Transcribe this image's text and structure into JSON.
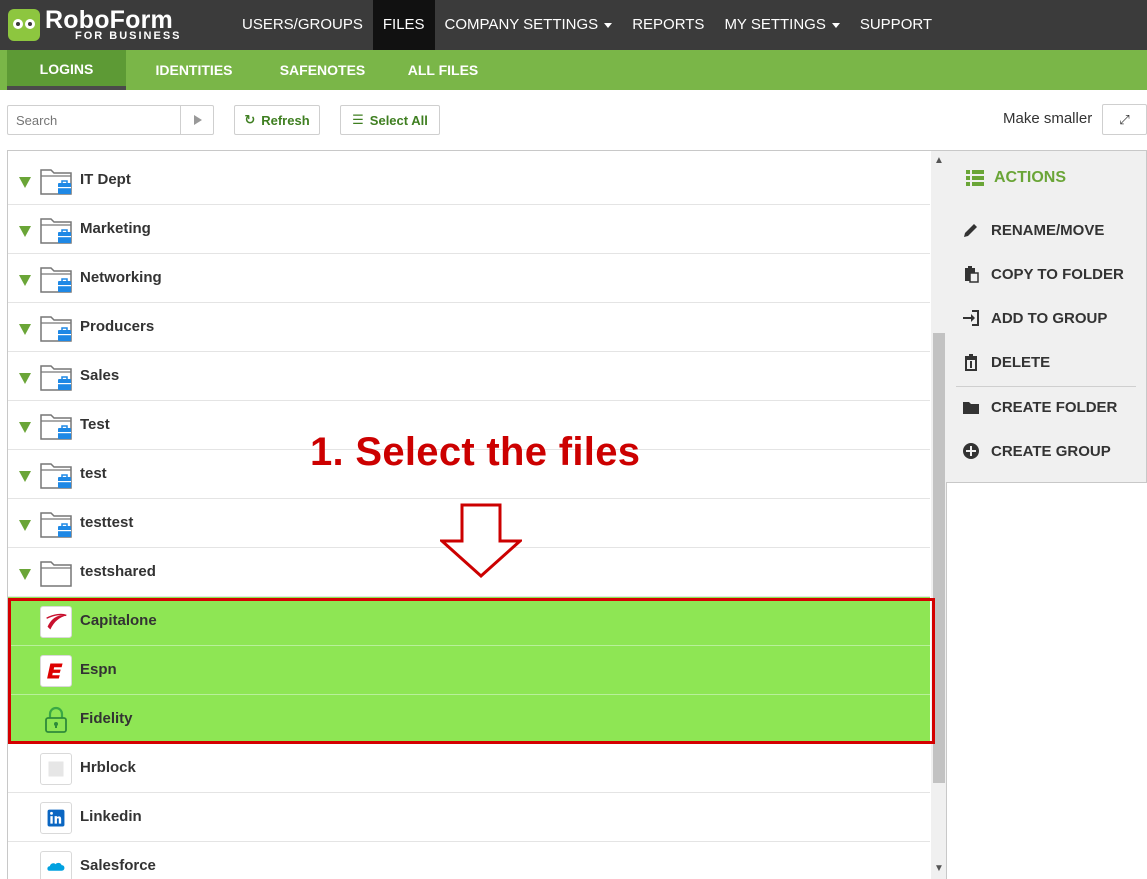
{
  "app": {
    "name": "RoboForm",
    "subtitle": "FOR BUSINESS"
  },
  "topnav": [
    {
      "label": "USERS/GROUPS",
      "dropdown": false,
      "active": false
    },
    {
      "label": "FILES",
      "dropdown": false,
      "active": true
    },
    {
      "label": "COMPANY SETTINGS",
      "dropdown": true,
      "active": false
    },
    {
      "label": "REPORTS",
      "dropdown": false,
      "active": false
    },
    {
      "label": "MY SETTINGS",
      "dropdown": true,
      "active": false
    },
    {
      "label": "SUPPORT",
      "dropdown": false,
      "active": false
    }
  ],
  "subnav": [
    {
      "label": "LOGINS",
      "active": true
    },
    {
      "label": "IDENTITIES",
      "active": false
    },
    {
      "label": "SAFENOTES",
      "active": false
    },
    {
      "label": "ALL FILES",
      "active": false
    }
  ],
  "toolbar": {
    "search_placeholder": "Search",
    "refresh_label": "Refresh",
    "select_all_label": "Select All",
    "make_smaller_label": "Make smaller"
  },
  "files": [
    {
      "name": "IT Dept",
      "kind": "folder",
      "shared": true,
      "selected": false
    },
    {
      "name": "Marketing",
      "kind": "folder",
      "shared": true,
      "selected": false
    },
    {
      "name": "Networking",
      "kind": "folder",
      "shared": true,
      "selected": false
    },
    {
      "name": "Producers",
      "kind": "folder",
      "shared": true,
      "selected": false
    },
    {
      "name": "Sales",
      "kind": "folder",
      "shared": true,
      "selected": false
    },
    {
      "name": "Test",
      "kind": "folder",
      "shared": true,
      "selected": false
    },
    {
      "name": "test",
      "kind": "folder",
      "shared": true,
      "selected": false
    },
    {
      "name": "testtest",
      "kind": "folder",
      "shared": true,
      "selected": false
    },
    {
      "name": "testshared",
      "kind": "folder",
      "shared": false,
      "selected": false
    },
    {
      "name": "Capitalone",
      "kind": "login",
      "icon": "capitalone-icon",
      "selected": true
    },
    {
      "name": "Espn",
      "kind": "login",
      "icon": "espn-icon",
      "selected": true
    },
    {
      "name": "Fidelity",
      "kind": "login",
      "icon": "lock-icon",
      "selected": true
    },
    {
      "name": "Hrblock",
      "kind": "login",
      "icon": "blank-site-icon",
      "selected": false
    },
    {
      "name": "Linkedin",
      "kind": "login",
      "icon": "linkedin-icon",
      "selected": false
    },
    {
      "name": "Salesforce",
      "kind": "login",
      "icon": "salesforce-icon",
      "selected": false
    }
  ],
  "annotation": {
    "text": "1. Select the files"
  },
  "actions": {
    "title": "ACTIONS",
    "items": [
      {
        "label": "RENAME/MOVE",
        "icon": "pencil-icon"
      },
      {
        "label": "COPY TO FOLDER",
        "icon": "clipboard-icon"
      },
      {
        "label": "ADD TO GROUP",
        "icon": "sign-in-icon"
      },
      {
        "label": "DELETE",
        "icon": "trash-icon"
      },
      {
        "label": "CREATE FOLDER",
        "icon": "folder-icon"
      },
      {
        "label": "CREATE GROUP",
        "icon": "plus-circle-icon"
      }
    ]
  },
  "colors": {
    "topbar": "#3b3b3b",
    "subbar": "#7ab648",
    "accent_green": "#6aa537",
    "selected_row": "#8ee654",
    "annotation_red": "#cc0000"
  }
}
